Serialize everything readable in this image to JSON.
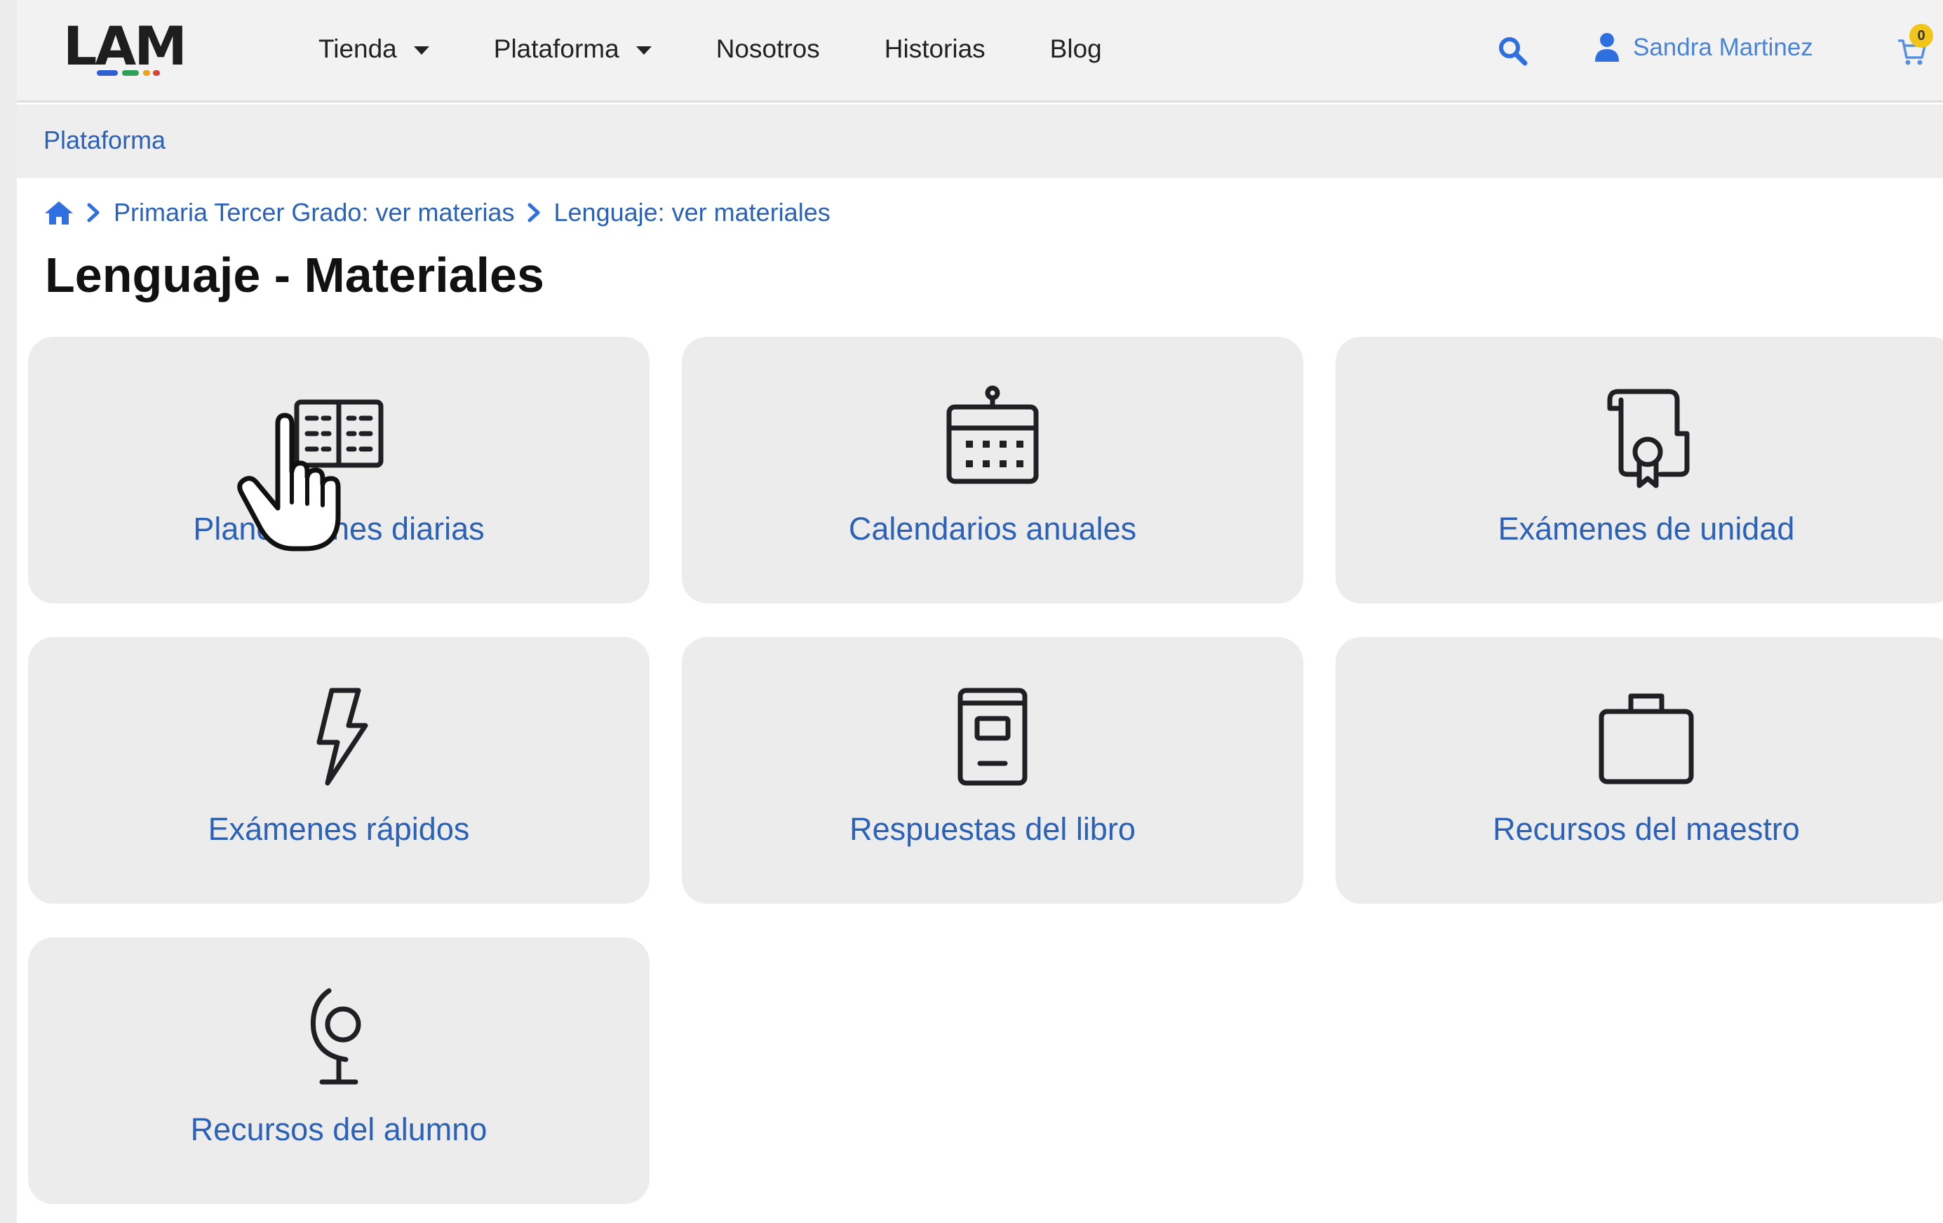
{
  "header": {
    "logo": "LAM",
    "logo_colors": [
      "#2f5fd0",
      "#2fa05a",
      "#e8a317",
      "#d4463b"
    ],
    "nav": [
      {
        "label": "Tienda",
        "has_dropdown": true
      },
      {
        "label": "Plataforma",
        "has_dropdown": true
      },
      {
        "label": "Nosotros",
        "has_dropdown": false
      },
      {
        "label": "Historias",
        "has_dropdown": false
      },
      {
        "label": "Blog",
        "has_dropdown": false
      }
    ],
    "search_icon": "search-icon",
    "user_icon": "user-icon",
    "user_name": "Sandra Martinez",
    "cart_icon": "cart-icon",
    "cart_count": "0"
  },
  "subheader": {
    "label": "Plataforma"
  },
  "breadcrumb": {
    "home_icon": "home-icon",
    "items": [
      "Primaria Tercer Grado: ver materias",
      "Lenguaje: ver materiales"
    ]
  },
  "page_title": "Lenguaje - Materiales",
  "cards": [
    {
      "label": "Planeaciones diarias",
      "icon": "open-book-icon"
    },
    {
      "label": "Calendarios anuales",
      "icon": "calendar-icon"
    },
    {
      "label": "Exámenes de unidad",
      "icon": "certificate-scroll-icon"
    },
    {
      "label": "Exámenes rápidos",
      "icon": "lightning-icon"
    },
    {
      "label": "Respuestas del libro",
      "icon": "book-icon"
    },
    {
      "label": "Recursos del maestro",
      "icon": "briefcase-icon"
    },
    {
      "label": "Recursos del alumno",
      "icon": "globe-icon"
    }
  ],
  "colors": {
    "link": "#2b62b8",
    "user_link": "#4a84d6",
    "card_bg": "#ececec",
    "badge": "#f2c519"
  },
  "cursor": "hand-pointer-icon"
}
